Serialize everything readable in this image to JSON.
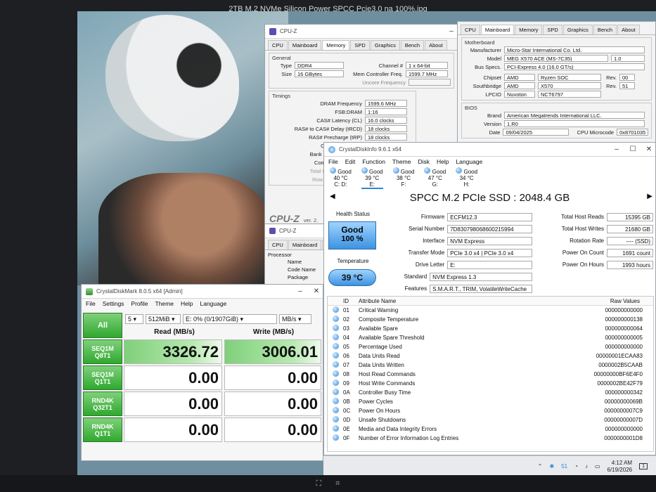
{
  "photo_title": "2TB M.2 NVMe Silicon Power SPCC Pcie3.0 na 100%.jpg",
  "cpuz_memory": {
    "title": "CPU-Z",
    "tabs": [
      "CPU",
      "Mainboard",
      "Memory",
      "SPD",
      "Graphics",
      "Bench",
      "About"
    ],
    "general_label": "General",
    "type_label": "Type",
    "type": "DDR4",
    "size_label": "Size",
    "size": "16 GBytes",
    "channel_label": "Channel #",
    "channel": "1 x 64-bit",
    "mcf_label": "Mem Controller Freq.",
    "mcf": "1599.7 MHz",
    "uncore_label": "Uncore Frequency",
    "timings_label": "Timings",
    "timings": [
      {
        "label": "DRAM Frequency",
        "value": "1599.6 MHz"
      },
      {
        "label": "FSB:DRAM",
        "value": "1:16"
      },
      {
        "label": "CAS# Latency (CL)",
        "value": "16.0 clocks"
      },
      {
        "label": "RAS# to CAS# Delay (tRCD)",
        "value": "18 clocks"
      },
      {
        "label": "RAS# Precharge (tRP)",
        "value": "18 clocks"
      }
    ],
    "partial_labels": [
      "Cyc",
      "Bank Cy",
      "Comm",
      "Total CA",
      "Row To"
    ],
    "logo": "CPU-Z",
    "version": "ver. 2."
  },
  "cpuz_mainboard": {
    "tabs": [
      "CPU",
      "Mainboard",
      "Memory",
      "SPD",
      "Graphics",
      "Bench",
      "About"
    ],
    "motherboard_label": "Motherboard",
    "manufacturer_label": "Manufacturer",
    "manufacturer": "Micro-Star International Co. Ltd.",
    "model_label": "Model",
    "model": "MEG X570 ACE (MS-7C35)",
    "model_rev": "1.0",
    "bus_label": "Bus Specs.",
    "bus": "PCI-Express 4.0 (16.0 GT/s)",
    "chipset_label": "Chipset",
    "chipset_vendor": "AMD",
    "chipset_name": "Ryzen SOC",
    "chipset_rev": "00",
    "southbridge_label": "Southbridge",
    "sb_vendor": "AMD",
    "sb_name": "X570",
    "sb_rev": "51",
    "lpcio_label": "LPCIO",
    "lpcio_vendor": "Nuvoton",
    "lpcio_name": "NCT6797",
    "rev_label": "Rev.",
    "bios_label": "BIOS",
    "brand_label": "Brand",
    "brand": "American Megatrends International LLC.",
    "version_label": "Version",
    "version": "1.R0",
    "date_label": "Date",
    "date": "09/04/2025",
    "microcode_label": "CPU Microcode",
    "microcode": "0x8701035"
  },
  "cpuz_cpu": {
    "title": "CPU-Z",
    "tabs": [
      "CPU",
      "Mainboard",
      "M"
    ],
    "processor_label": "Processor",
    "rows": [
      "Name",
      "Code Name",
      "Package"
    ]
  },
  "cdm": {
    "title": "CrystalDiskMark 8.0.5 x64 [Admin]",
    "menu": [
      "File",
      "Settings",
      "Profile",
      "Theme",
      "Help",
      "Language"
    ],
    "all_label": "All",
    "count": "5",
    "size": "512MiB",
    "drive": "E: 0% (0/1907GiB)",
    "unit": "MB/s",
    "read_header": "Read (MB/s)",
    "write_header": "Write (MB/s)",
    "tests": [
      {
        "line1": "SEQ1M",
        "line2": "Q8T1",
        "read": "3326.72",
        "write": "3006.01"
      },
      {
        "line1": "SEQ1M",
        "line2": "Q1T1",
        "read": "0.00",
        "write": "0.00"
      },
      {
        "line1": "RND4K",
        "line2": "Q32T1",
        "read": "0.00",
        "write": "0.00"
      },
      {
        "line1": "RND4K",
        "line2": "Q1T1",
        "read": "0.00",
        "write": "0.00"
      }
    ]
  },
  "cdi": {
    "title": "CrystalDiskInfo 9.6.1 x64",
    "menu": [
      "File",
      "Edit",
      "Function",
      "Theme",
      "Disk",
      "Help",
      "Language"
    ],
    "drives": [
      {
        "status": "Good",
        "temp": "40 °C",
        "letter": "C: D:"
      },
      {
        "status": "Good",
        "temp": "39 °C",
        "letter": "E:"
      },
      {
        "status": "Good",
        "temp": "38 °C",
        "letter": "F:"
      },
      {
        "status": "Good",
        "temp": "47 °C",
        "letter": "G:"
      },
      {
        "status": "Good",
        "temp": "34 °C",
        "letter": "H:"
      }
    ],
    "model": "SPCC M.2 PCIe SSD : 2048.4 GB",
    "health_label": "Health Status",
    "health_status": "Good",
    "health_pct": "100 %",
    "temp_label": "Temperature",
    "temp": "39 °C",
    "firmware_label": "Firmware",
    "firmware": "ECFM12.3",
    "serial_label": "Serial Number",
    "serial": "7D830798068600215994",
    "interface_label": "Interface",
    "interface": "NVM Express",
    "transfer_label": "Transfer Mode",
    "transfer": "PCIe 3.0 x4 | PCIe 3.0 x4",
    "letter_label": "Drive Letter",
    "letter": "E:",
    "standard_label": "Standard",
    "standard": "NVM Express 1.3",
    "features_label": "Features",
    "features": "S.M.A.R.T., TRIM, VolatileWriteCache",
    "thr_label": "Total Host Reads",
    "thr": "15395 GB",
    "thw_label": "Total Host Writes",
    "thw": "21680 GB",
    "rot_label": "Rotation Rate",
    "rot": "---- (SSD)",
    "poc_label": "Power On Count",
    "poc": "1691 count",
    "poh_label": "Power On Hours",
    "poh": "1993 hours",
    "col_id": "ID",
    "col_name": "Attribute Name",
    "col_raw": "Raw Values",
    "attributes": [
      {
        "id": "01",
        "name": "Critical Warning",
        "raw": "000000000000"
      },
      {
        "id": "02",
        "name": "Composite Temperature",
        "raw": "000000000138"
      },
      {
        "id": "03",
        "name": "Available Spare",
        "raw": "000000000064"
      },
      {
        "id": "04",
        "name": "Available Spare Threshold",
        "raw": "000000000005"
      },
      {
        "id": "05",
        "name": "Percentage Used",
        "raw": "000000000000"
      },
      {
        "id": "06",
        "name": "Data Units Read",
        "raw": "00000001ECAA83"
      },
      {
        "id": "07",
        "name": "Data Units Written",
        "raw": "0000002B5CAAB"
      },
      {
        "id": "08",
        "name": "Host Read Commands",
        "raw": "00000000BF6E4F0"
      },
      {
        "id": "09",
        "name": "Host Write Commands",
        "raw": "0000002BE42F79"
      },
      {
        "id": "0A",
        "name": "Controller Busy Time",
        "raw": "000000000342"
      },
      {
        "id": "0B",
        "name": "Power Cycles",
        "raw": "00000000069B"
      },
      {
        "id": "0C",
        "name": "Power On Hours",
        "raw": "0000000007C9"
      },
      {
        "id": "0D",
        "name": "Unsafe Shutdowns",
        "raw": "00000000007D"
      },
      {
        "id": "0E",
        "name": "Media and Data Integrity Errors",
        "raw": "000000000000"
      },
      {
        "id": "0F",
        "name": "Number of Error Information Log Entries",
        "raw": "0000000001D8"
      }
    ]
  },
  "taskbar": {
    "badge": "51",
    "time": "4:12 AM",
    "date": "6/19/2026",
    "notification": "1"
  },
  "colors": {
    "accent_green": "#2fa82f",
    "health_blue": "#2f86d8"
  }
}
